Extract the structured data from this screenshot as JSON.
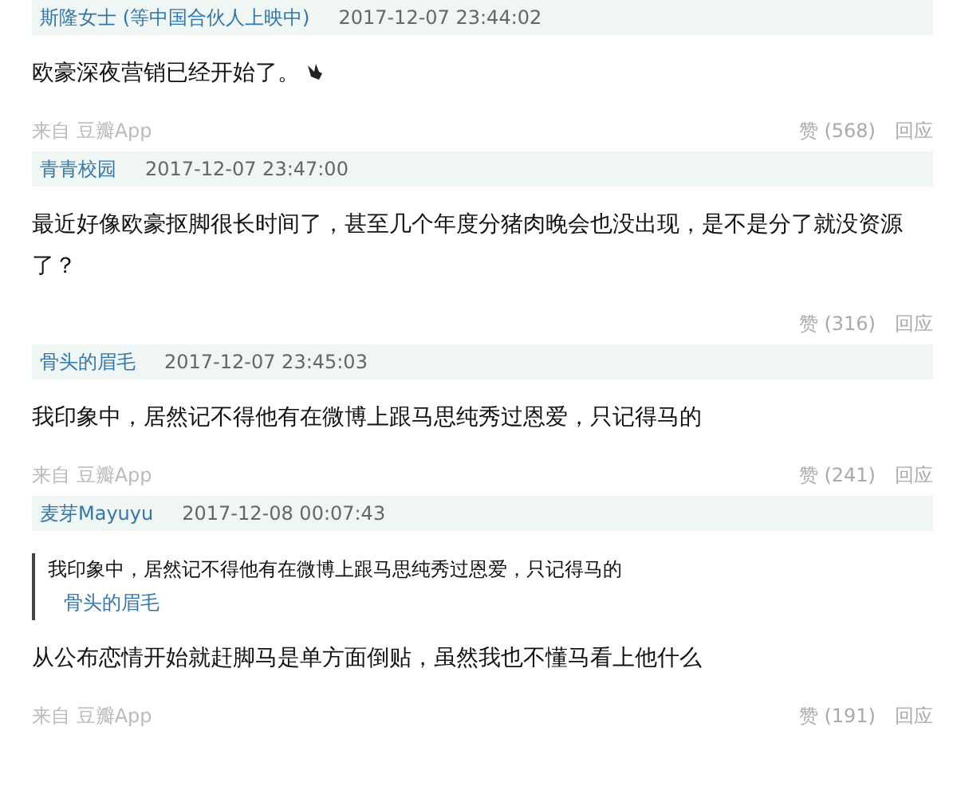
{
  "comments": [
    {
      "author": "斯隆女士 (等中国合伙人上映中)",
      "time": "2017-12-07 23:44:02",
      "body": "欧豪深夜营销已经开始了。",
      "emoji": true,
      "source": "来自 豆瓣App",
      "likes": "赞 (568)",
      "reply": "回应"
    },
    {
      "author": "青青校园",
      "time": "2017-12-07 23:47:00",
      "body": "最近好像欧豪抠脚很长时间了，甚至几个年度分猪肉晚会也没出现，是不是分了就没资源了？",
      "likes": "赞 (316)",
      "reply": "回应"
    },
    {
      "author": "骨头的眉毛",
      "time": "2017-12-07 23:45:03",
      "body": "我印象中，居然记不得他有在微博上跟马思纯秀过恩爱，只记得马的",
      "source": "来自 豆瓣App",
      "likes": "赞 (241)",
      "reply": "回应"
    },
    {
      "author": "麦芽Mayuyu",
      "time": "2017-12-08 00:07:43",
      "quote": {
        "text": "我印象中，居然记不得他有在微博上跟马思纯秀过恩爱，只记得马的",
        "author": "骨头的眉毛"
      },
      "body": "从公布恋情开始就赶脚马是单方面倒贴，虽然我也不懂马看上他什么",
      "source": "来自 豆瓣App",
      "likes": "赞 (191)",
      "reply": "回应"
    }
  ]
}
